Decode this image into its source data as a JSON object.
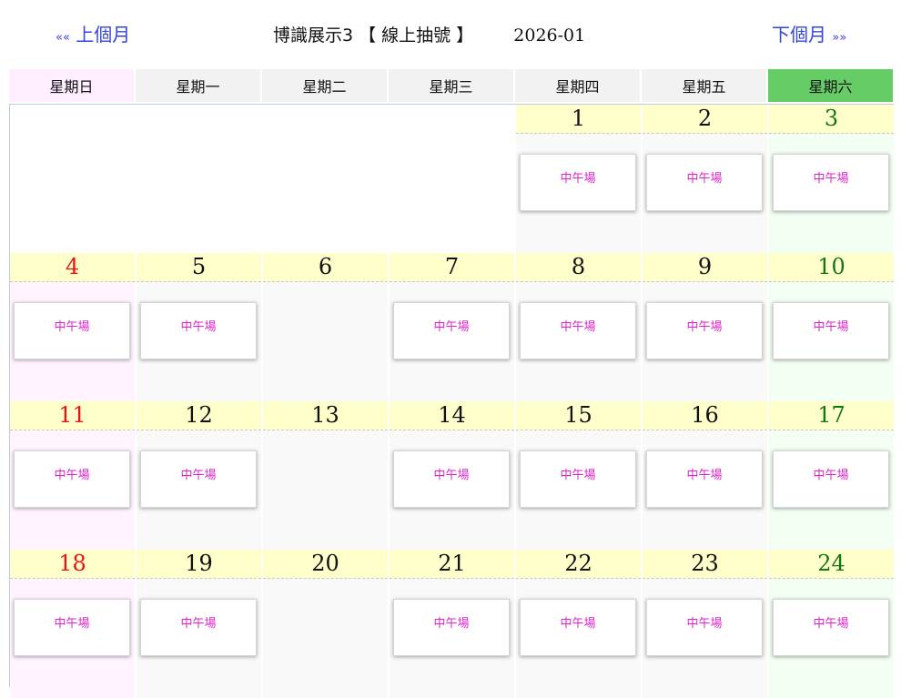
{
  "nav": {
    "prev_arrows": "««",
    "prev_label": "上個月",
    "next_label": "下個月",
    "next_arrows": "»»"
  },
  "title": {
    "venue": "博識展示3 【 線上抽號 】",
    "year_month": "2026-01"
  },
  "weekdays": [
    "星期日",
    "星期一",
    "星期二",
    "星期三",
    "星期四",
    "星期五",
    "星期六"
  ],
  "slot_label": "中午場",
  "weeks": [
    [
      {
        "day": "",
        "slot": false
      },
      {
        "day": "",
        "slot": false
      },
      {
        "day": "",
        "slot": false
      },
      {
        "day": "",
        "slot": false
      },
      {
        "day": "1",
        "slot": true
      },
      {
        "day": "2",
        "slot": true
      },
      {
        "day": "3",
        "slot": true
      }
    ],
    [
      {
        "day": "4",
        "slot": true
      },
      {
        "day": "5",
        "slot": true
      },
      {
        "day": "6",
        "slot": false
      },
      {
        "day": "7",
        "slot": true
      },
      {
        "day": "8",
        "slot": true
      },
      {
        "day": "9",
        "slot": true
      },
      {
        "day": "10",
        "slot": true
      }
    ],
    [
      {
        "day": "11",
        "slot": true
      },
      {
        "day": "12",
        "slot": true
      },
      {
        "day": "13",
        "slot": false
      },
      {
        "day": "14",
        "slot": true
      },
      {
        "day": "15",
        "slot": true
      },
      {
        "day": "16",
        "slot": true
      },
      {
        "day": "17",
        "slot": true
      }
    ],
    [
      {
        "day": "18",
        "slot": true
      },
      {
        "day": "19",
        "slot": true
      },
      {
        "day": "20",
        "slot": false
      },
      {
        "day": "21",
        "slot": true
      },
      {
        "day": "22",
        "slot": true
      },
      {
        "day": "23",
        "slot": true
      },
      {
        "day": "24",
        "slot": true
      }
    ]
  ],
  "colors": {
    "link": "#3344dd",
    "slot_text": "#dd22cc",
    "sunday_number": "#ee1111",
    "saturday_number": "#117711",
    "day_header_bg": "#ffffcc",
    "saturday_header_bg": "#66cc66",
    "sunday_header_bg": "#ffeeff"
  }
}
